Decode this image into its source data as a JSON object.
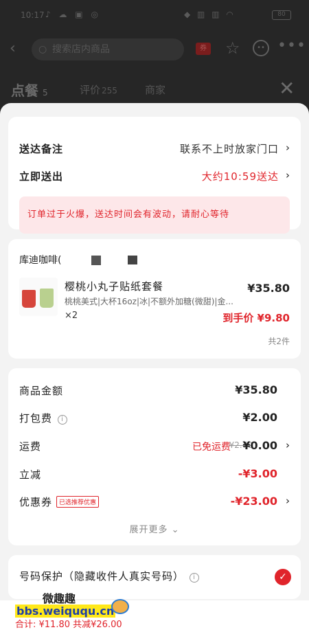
{
  "status_bar": {
    "time": "10:17",
    "battery": "80"
  },
  "header": {
    "search_placeholder": "搜索店内商品"
  },
  "tabs": {
    "order": "点餐",
    "order_count": "5",
    "reviews": "评价",
    "reviews_count": "255",
    "shop": "商家"
  },
  "delivery": {
    "note_label": "送达备注",
    "note_value": "联系不上时放家门口",
    "time_label": "立即送出",
    "time_value": "大约10:59送达",
    "notice": "订单过于火爆，送达时间会有波动，请耐心等待"
  },
  "shop": {
    "name": "库迪咖啡(",
    "item": {
      "name": "樱桃小丸子贴纸套餐",
      "price": "¥35.80",
      "spec": "桃桃美式|大杯16oz|冰|不额外加糖(微甜)|金...",
      "qty": "×2",
      "deal_price": "到手价 ¥9.80"
    },
    "total_count": "共2件"
  },
  "fees": {
    "goods_label": "商品金额",
    "goods_amount": "¥35.80",
    "packing_label": "打包费",
    "packing_amount": "¥2.00",
    "shipping_label": "运费",
    "shipping_free": "已免运费",
    "shipping_original": "¥2.70",
    "shipping_amount": "¥0.00",
    "discount_label": "立减",
    "discount_amount": "-¥3.00",
    "coupon_label": "优惠券",
    "coupon_tag": "已选推荐优惠",
    "coupon_amount": "-¥23.00",
    "expand": "展开更多"
  },
  "privacy": {
    "label": "号码保护（隐藏收件人真实号码）"
  },
  "footer": {
    "total": "合计: ¥11.80 共减¥26.00"
  },
  "watermark": {
    "name": "微趣趣",
    "url": "bbs.weiququ.cn"
  },
  "colors": {
    "accent": "#e0242b",
    "notice_bg": "#fde7e9"
  }
}
